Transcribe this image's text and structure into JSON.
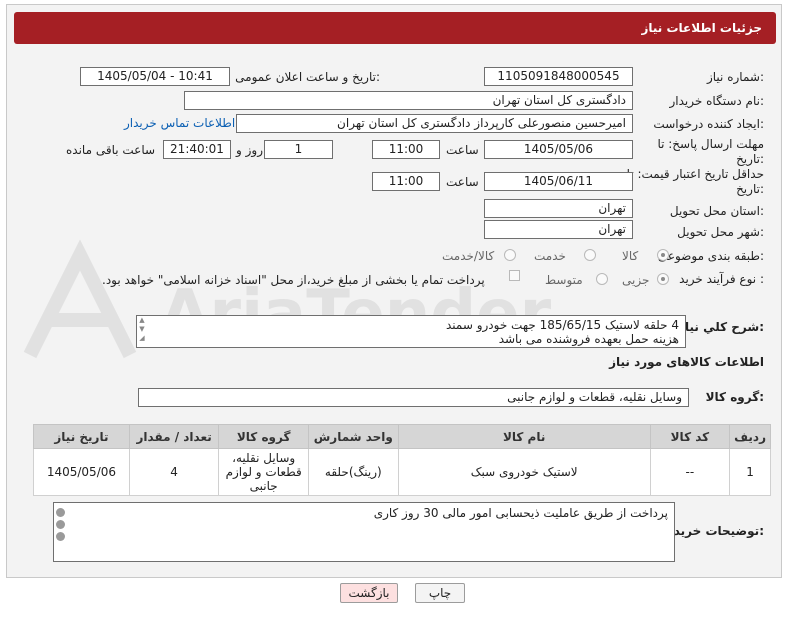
{
  "header": {
    "title": "جزئیات اطلاعات نیاز"
  },
  "form": {
    "need_number": {
      "label": "شماره نیاز:",
      "value": "1105091848000545"
    },
    "announce_datetime": {
      "label": "تاریخ و ساعت اعلان عمومی:",
      "value": "1405/05/04 - 10:41"
    },
    "buyer_org": {
      "label": "نام دستگاه خریدار:",
      "value": "دادگستری کل استان تهران"
    },
    "requester": {
      "label": "ایجاد کننده درخواست:",
      "value": "امیرحسین منصورعلی کارپرداز دادگستری کل استان تهران",
      "contact_link": "اطلاعات تماس خریدار"
    },
    "response_deadline": {
      "label": "مهلت ارسال پاسخ: تا تاریخ:",
      "date": "1405/05/06",
      "time_label": "ساعت",
      "time": "11:00",
      "days": "1",
      "days_label": "روز و",
      "remaining": "21:40:01",
      "remaining_label": "ساعت باقی مانده"
    },
    "price_validity": {
      "label": "حداقل تاریخ اعتبار قیمت: تا تاریخ:",
      "date": "1405/06/11",
      "time_label": "ساعت",
      "time": "11:00"
    },
    "delivery_province": {
      "label": "استان محل تحویل:",
      "value": "تهران"
    },
    "delivery_city": {
      "label": "شهر محل تحویل:",
      "value": "تهران"
    },
    "category": {
      "label": "طبقه بندی موضوعی:",
      "options": [
        "کالا",
        "خدمت",
        "کالا/خدمت"
      ],
      "selected": "کالا"
    },
    "purchase_process": {
      "label": "نوع فرآیند خرید :",
      "options": [
        "جزیی",
        "متوسط"
      ],
      "selected": "جزیی",
      "payment_note": "پرداخت تمام یا بخشی از مبلغ خرید،از محل \"اسناد خزانه اسلامی\" خواهد بود."
    }
  },
  "summary": {
    "label": "شرح کلي نياز:",
    "line1": "4 حلقه لاستیک 185/65/15 جهت خودرو سمند",
    "line2": "هزینه حمل بعهده فروشنده می باشد"
  },
  "goods_info": {
    "title": "اطلاعات کالاهای مورد نیاز"
  },
  "goods_group": {
    "label": "گروه کالا:",
    "value": "وسایل نقلیه، قطعات و لوازم جانبی"
  },
  "table": {
    "headers": [
      "ردیف",
      "کد کالا",
      "نام کالا",
      "واحد شمارش",
      "گروه کالا",
      "تعداد / مقدار",
      "تاریخ نیاز"
    ],
    "rows": [
      {
        "row": "1",
        "code": "--",
        "name": "لاستیک خودروی سبک",
        "unit": "(رینگ)حلقه",
        "group": "وسایل نقلیه، قطعات و لوازم جانبی",
        "qty": "4",
        "date": "1405/05/06"
      }
    ]
  },
  "buyer_notes": {
    "label": "توضیحات خریدار:",
    "value": "پرداخت از طریق عاملیت ذیحسابی امور مالی 30 روز کاری"
  },
  "buttons": {
    "print": "چاپ",
    "back": "بازگشت"
  },
  "colors": {
    "title_bar": "#a51f24",
    "link": "#0b5fb3",
    "back_button": "#fde0e0"
  }
}
